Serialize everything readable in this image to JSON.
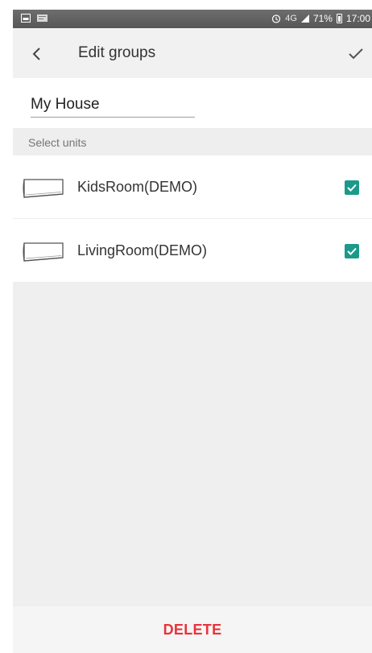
{
  "status_bar": {
    "battery_percent": "71%",
    "time": "17:00",
    "network": "4G"
  },
  "app_bar": {
    "title": "Edit groups",
    "back_icon": "chevron-left-icon",
    "confirm_icon": "checkmark-icon"
  },
  "group_name": {
    "value": "My House"
  },
  "section": {
    "label": "Select units"
  },
  "units": [
    {
      "name": "KidsRoom(DEMO)",
      "checked": true
    },
    {
      "name": "LivingRoom(DEMO)",
      "checked": true
    }
  ],
  "footer": {
    "delete_label": "DELETE"
  },
  "colors": {
    "accent_checkbox": "#1b9a8a",
    "delete_red": "#e8333c"
  }
}
